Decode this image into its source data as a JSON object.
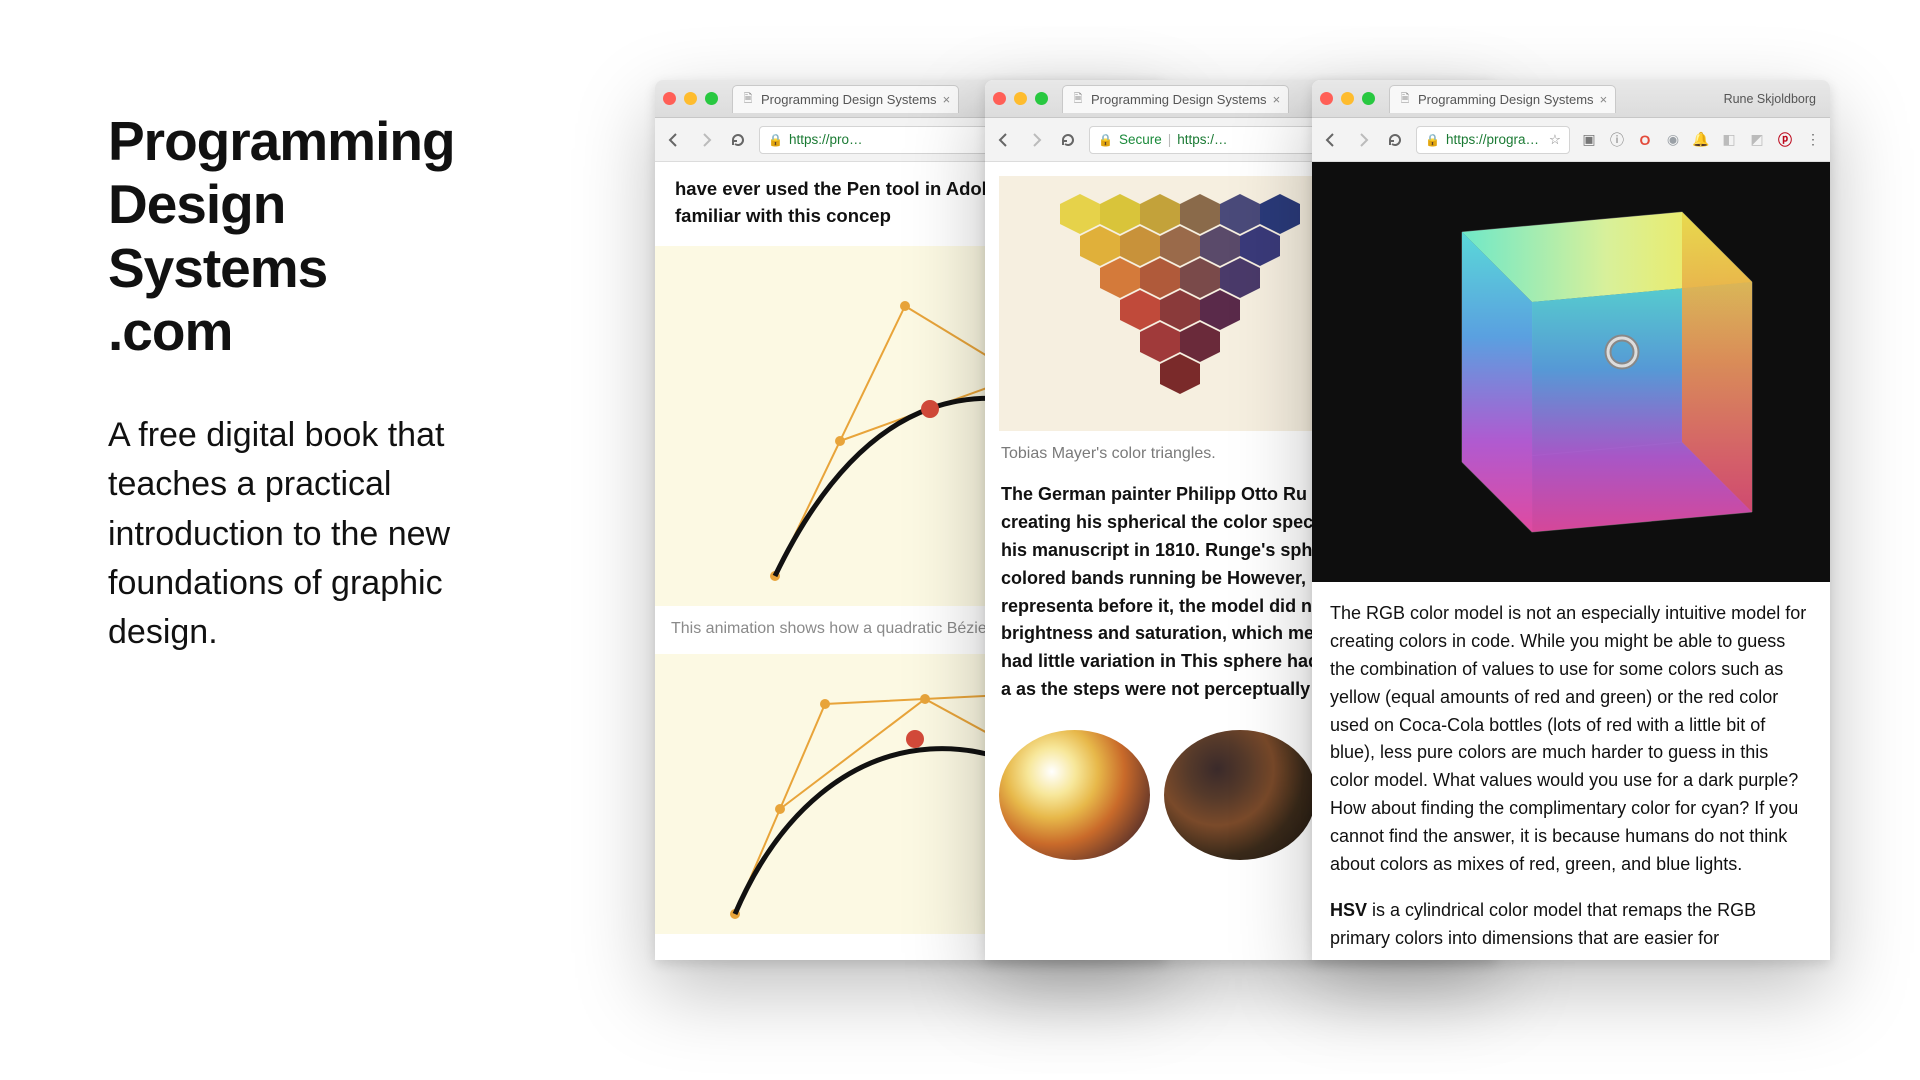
{
  "hero": {
    "title_l1": "Programming",
    "title_l2": "Design",
    "title_l3": "Systems",
    "title_l4": ".com",
    "subtitle": "A free digital book that teaches a practical introduction to the new foundations of graphic design."
  },
  "win1": {
    "tab_title": "Programming Design Systems",
    "url_text": "https://pro…",
    "body_top": "have ever used the Pen tool in Adobe are already familiar with this concep",
    "caption": "This animation shows how a quadratic Bézie"
  },
  "win2": {
    "tab_title": "Programming Design Systems",
    "secure_label": "Secure",
    "url_text": "https:/…",
    "caption": "Tobias Mayer's color triangles.",
    "body": "The German painter Philipp Otto Ru approach when creating his spherical the color spectrum, published in his manuscript in 1810. Runge's sphere poles with colored bands running be However, like many other representa before it, the model did not different brightness and saturation, which me resulting model had little variation in This sphere had the same problem a as the steps were not perceptually u"
  },
  "win3": {
    "tab_title": "Programming Design Systems",
    "url_text": "https://progra…",
    "profile": "Rune Skjoldborg",
    "p1": "The RGB color model is not an especially intuitive model for creating colors in code. While you might be able to guess the combination of values to use for some colors such as yellow (equal amounts of red and green) or the red color used on Coca-Cola bottles (lots of red with a little bit of blue), less pure colors are much harder to guess in this color model. What values would you use for a dark purple? How about finding the complimentary color for cyan? If you cannot find the answer, it is because humans do not think about colors as mixes of red, green, and blue lights.",
    "hsv_label": "HSV",
    "p2_rest": " is a cylindrical color model that remaps the RGB primary colors into dimensions that are easier for"
  },
  "ext_colors": {
    "opera": "#e34a3a",
    "camera": "#9aa0a6",
    "bell": "#5aa9ff",
    "pinterest": "#bd081c"
  }
}
